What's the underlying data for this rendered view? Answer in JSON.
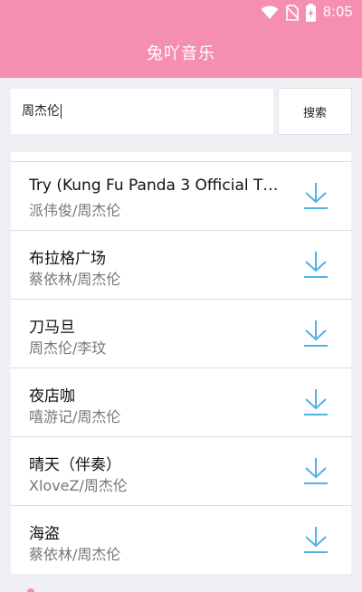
{
  "status": {
    "time": "8:05"
  },
  "header": {
    "title": "兔吖音乐"
  },
  "search": {
    "query": "周杰伦",
    "button_label": "搜索"
  },
  "results": [
    {
      "song": "Try (Kung Fu Panda 3 Official The...",
      "artist": "派伟俊/周杰伦"
    },
    {
      "song": "布拉格广场",
      "artist": "蔡依林/周杰伦"
    },
    {
      "song": "刀马旦",
      "artist": "周杰伦/李玟"
    },
    {
      "song": "夜店咖",
      "artist": "嘻游记/周杰伦"
    },
    {
      "song": "晴天（伴奏）",
      "artist": "XloveZ/周杰伦"
    },
    {
      "song": "海盗",
      "artist": "蔡依林/周杰伦"
    }
  ],
  "colors": {
    "accent": "#f48fb1",
    "download_icon": "#4fb3e6"
  },
  "icons": [
    "wifi-icon",
    "no-sim-icon",
    "battery-icon",
    "download-icon"
  ]
}
